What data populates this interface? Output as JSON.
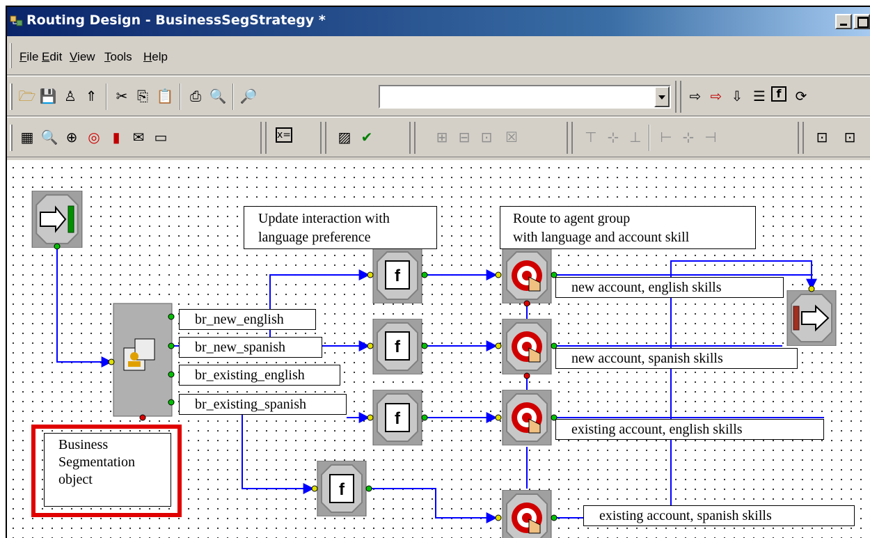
{
  "window": {
    "title": "Routing Design - BusinessSegStrategy *"
  },
  "menu": [
    "File",
    "Edit",
    "View",
    "Tools",
    "Help"
  ],
  "toolbar": {
    "search_value": ""
  },
  "diagram": {
    "notes": {
      "update_interaction": "Update interaction with\nlanguage preference",
      "route_to_agent": "Route to agent group\nwith language and account skill",
      "business_segmentation": "Business\nSegmentation\nobject"
    },
    "branches": [
      "br_new_english",
      "br_new_spanish",
      "br_existing_english",
      "br_existing_spanish"
    ],
    "targets": [
      "new account, english skills",
      "new account, spanish skills",
      "existing account, english skills",
      "existing account, spanish skills"
    ]
  },
  "colors": {
    "connector": "#0000ff",
    "highlight": "#e00000",
    "titlebar": "#0a246a"
  }
}
